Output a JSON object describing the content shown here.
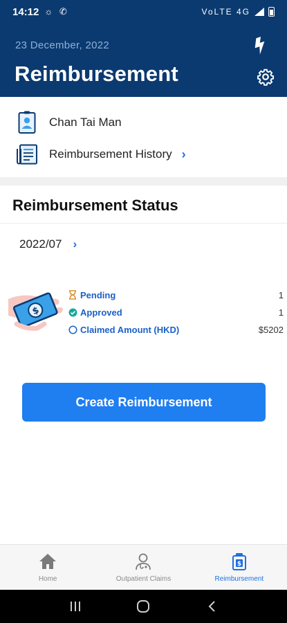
{
  "statusbar": {
    "time": "14:12",
    "left_icons": "☼ ✆",
    "right_icons": "VoLTE 4G",
    "battery_icon": "battery-icon"
  },
  "header": {
    "date": "23 December, 2022",
    "title": "Reimbursement",
    "bg_color": "#0b3a70"
  },
  "profile": {
    "name": "Chan Tai Man",
    "history_label": "Reimbursement History"
  },
  "status": {
    "title": "Reimbursement Status",
    "period": "2022/07",
    "rows": [
      {
        "label": "Pending",
        "value": "1"
      },
      {
        "label": "Approved",
        "value": "1"
      },
      {
        "label": "Claimed Amount (HKD)",
        "value": "$5202"
      }
    ]
  },
  "cta": {
    "label": "Create Reimbursement",
    "color": "#1f7ef0"
  },
  "bottom_nav": [
    {
      "label": "Home",
      "icon": "home-icon",
      "active": false
    },
    {
      "label": "Outpatient Claims",
      "icon": "doctor-icon",
      "active": false
    },
    {
      "label": "Reimbursement",
      "icon": "receipt-icon",
      "active": true
    }
  ]
}
